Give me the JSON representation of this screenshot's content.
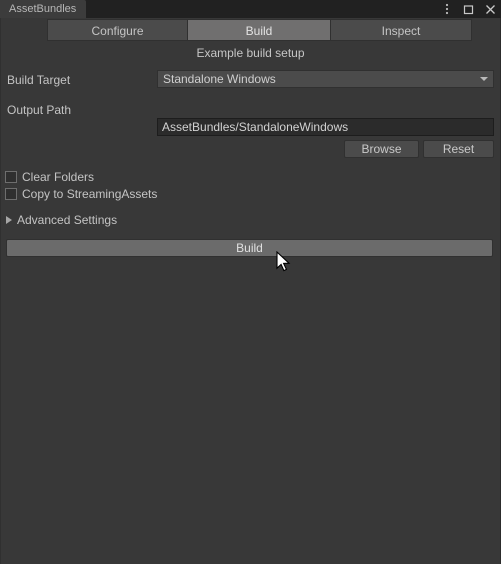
{
  "window": {
    "tab_title": "AssetBundles",
    "controls": [
      {
        "name": "more-options",
        "label": "⋮"
      },
      {
        "name": "maximize",
        "label": "□"
      },
      {
        "name": "close",
        "label": "✕"
      }
    ]
  },
  "modes": {
    "tabs": [
      {
        "label": "Configure",
        "selected": false
      },
      {
        "label": "Build",
        "selected": true
      },
      {
        "label": "Inspect",
        "selected": false
      }
    ]
  },
  "main": {
    "subtitle": "Example build setup",
    "build_target": {
      "label": "Build Target",
      "value": "Standalone Windows"
    },
    "output_path": {
      "label": "Output Path",
      "value": "AssetBundles/StandaloneWindows",
      "placeholder": "AssetBundles/StandaloneWindows"
    },
    "buttons": {
      "browse": "Browse",
      "reset": "Reset"
    },
    "checkboxes": [
      {
        "label": "Clear Folders",
        "checked": false
      },
      {
        "label": "Copy to StreamingAssets",
        "checked": false
      }
    ],
    "advanced_settings": {
      "label": "Advanced Settings",
      "expanded": false
    },
    "build_button": "Build"
  },
  "colors": {
    "window_bg": "#383838",
    "titlebar_bg": "#212121",
    "tab_selected": "#706f6f",
    "tab_normal": "#4b4b4b",
    "field_bg": "#2b2b2b",
    "text": "#c4c4c4",
    "build_button": "#6b6b6b"
  }
}
